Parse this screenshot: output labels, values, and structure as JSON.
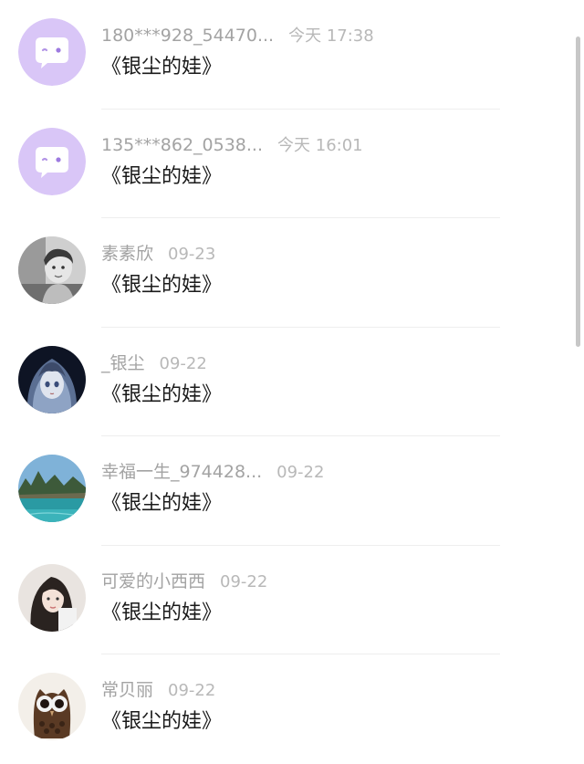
{
  "comments": [
    {
      "name": "180***928_54470...",
      "time": "今天 17:38",
      "text": "《银尘的娃》",
      "avatar": "default-chat-avatar-icon"
    },
    {
      "name": "135***862_0538...",
      "time": "今天 16:01",
      "text": "《银尘的娃》",
      "avatar": "default-chat-avatar-icon"
    },
    {
      "name": "素素欣",
      "time": "09-23",
      "text": "《银尘的娃》",
      "avatar": "child-photo"
    },
    {
      "name": "_银尘",
      "time": "09-22",
      "text": "《银尘的娃》",
      "avatar": "anime-girl-photo"
    },
    {
      "name": "幸福一生_974428...",
      "time": "09-22",
      "text": "《银尘的娃》",
      "avatar": "lake-landscape-photo"
    },
    {
      "name": "可爱的小西西",
      "time": "09-22",
      "text": "《银尘的娃》",
      "avatar": "girl-selfie-photo"
    },
    {
      "name": "常贝丽",
      "time": "09-22",
      "text": "《银尘的娃》",
      "avatar": "owl-coffee-beans-photo"
    }
  ],
  "colors": {
    "default_avatar_bg": "#d9c6f7",
    "name_text": "#a3a3a3",
    "comment_text": "#1a1a1a"
  }
}
